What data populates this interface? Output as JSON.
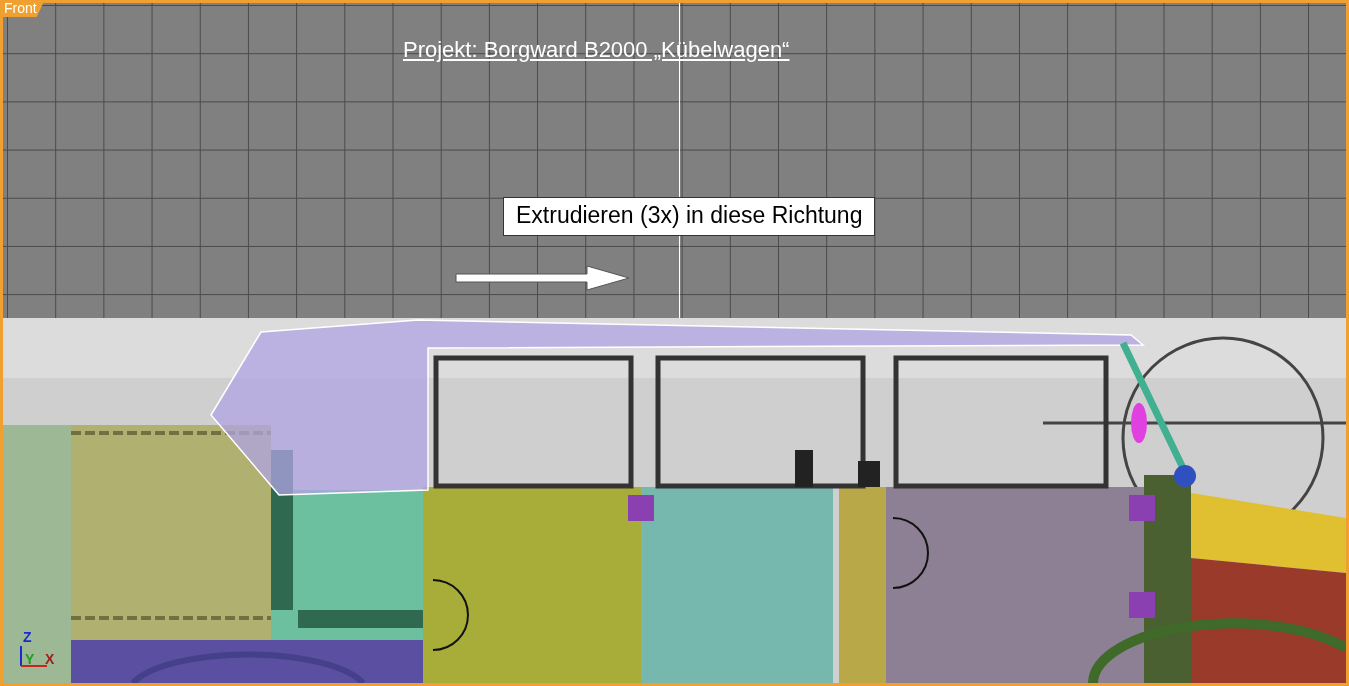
{
  "viewport": {
    "label": "Front"
  },
  "title": "Projekt: Borgward B2000 „Kübelwagen“",
  "callout": "Extrudieren (3x) in diese Richtung",
  "axes": [
    "Z",
    "Y",
    "X"
  ]
}
